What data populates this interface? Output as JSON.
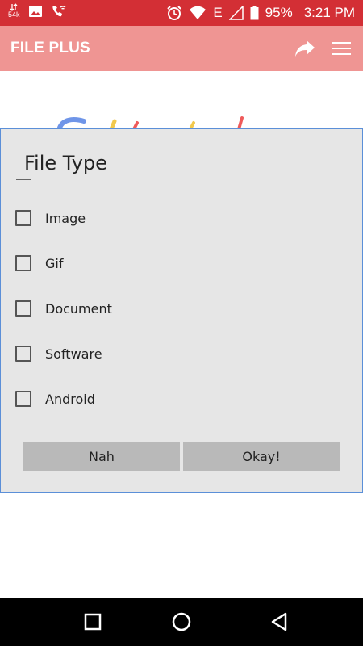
{
  "status_bar": {
    "network_speed": "54k",
    "battery_percent": "95%",
    "network_type": "E",
    "time": "3:21 PM",
    "icons": [
      "data-speed-icon",
      "gallery-icon",
      "wifi-call-icon",
      "alarm-icon",
      "wifi-icon",
      "signal-icon",
      "battery-icon"
    ]
  },
  "app_bar": {
    "title": "FILE PLUS",
    "background": "#ef9593",
    "icons": [
      "share-icon",
      "menu-icon"
    ]
  },
  "dialog": {
    "title": "File Type",
    "options": [
      {
        "label": "Image",
        "checked": false
      },
      {
        "label": "Gif",
        "checked": false
      },
      {
        "label": "Document",
        "checked": false
      },
      {
        "label": "Software",
        "checked": false
      },
      {
        "label": "Android",
        "checked": false
      }
    ],
    "buttons": {
      "cancel_label": "Nah",
      "confirm_label": "Okay!"
    }
  },
  "nav_bar": {
    "icons": [
      "recents-square-icon",
      "home-circle-icon",
      "back-triangle-icon"
    ]
  }
}
